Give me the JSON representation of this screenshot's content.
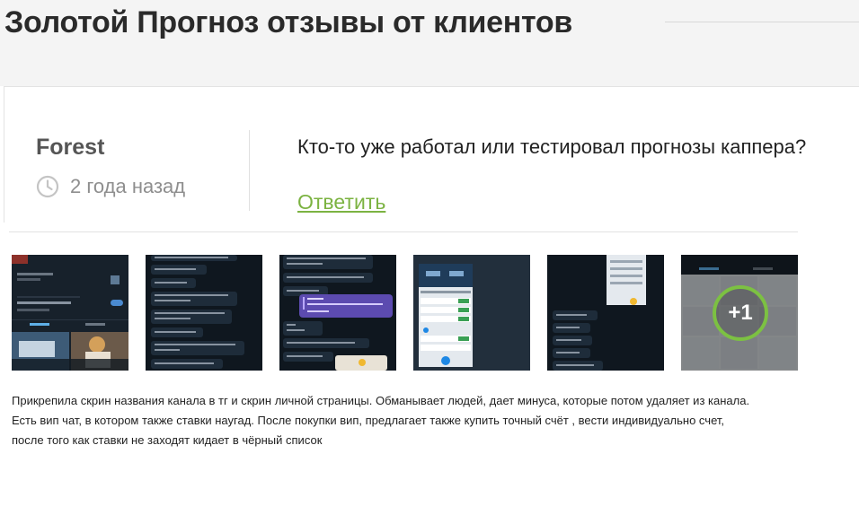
{
  "page": {
    "title": "Золотой Прогноз отзывы от клиентов"
  },
  "review": {
    "author": "Forest",
    "time_ago": "2 года назад",
    "question": "Кто-то уже работал или тестировал прогнозы каппера?",
    "reply_label": "Ответить",
    "more_images_label": "+1",
    "description_lines": [
      "Прикрепила скрин названия канала в тг и скрин личной страницы. Обманывает людей, дает минуса, которые потом удаляет из канала.",
      "Есть вип чат, в котором также ставки наугад. После покупки вип, предлагает также купить точный счёт , вести индивидуально счет,",
      "после того как ставки не заходят кидает в чёрный список"
    ]
  },
  "colors": {
    "accent_green": "#7cb342",
    "title_text": "#2a2a2a",
    "muted_text": "#8e8e8e",
    "thumb_dark": "#17212b"
  },
  "icons": {
    "time": "clock-icon"
  }
}
